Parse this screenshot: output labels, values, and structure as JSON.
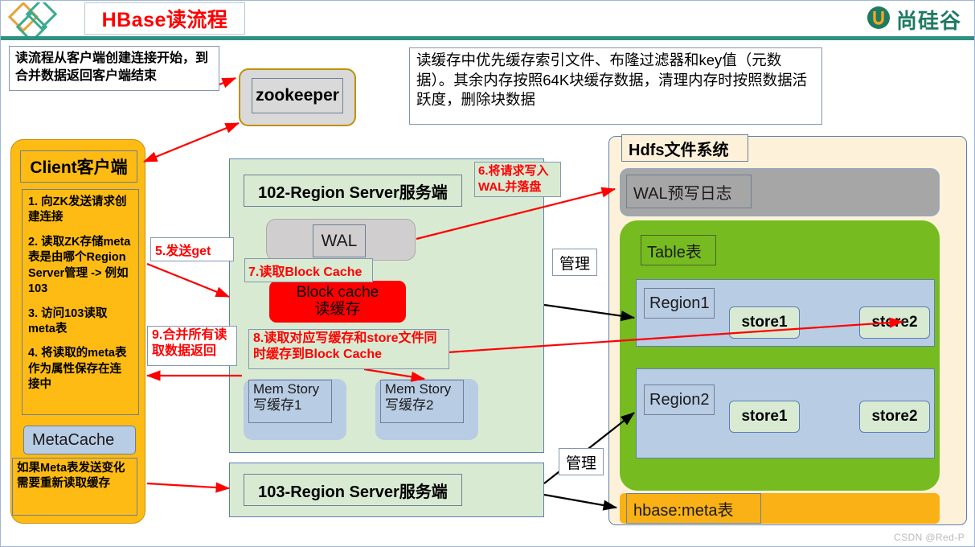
{
  "header": {
    "title": "HBase读流程",
    "brand_text": "尚硅谷",
    "logo_icon": "diamonds-logo-icon",
    "brand_icon": "u-circle-logo-icon"
  },
  "notes": {
    "left_note": "读流程从客户端创建连接开始，到合并数据返回客户端结束",
    "cache_note": "读缓存中优先缓存索引文件、布隆过滤器和key值（元数据）。其余内存按照64K块缓存数据，清理内存时按照数据活跃度，删除块数据"
  },
  "client": {
    "title": "Client客户端",
    "steps": [
      "1. 向ZK发送请求创建连接",
      "2. 读取ZK存储meta表是由哪个Region Server管理 -> 例如103",
      "3. 访问103读取meta表",
      "4. 将读取的meta表作为属性保存在连接中"
    ],
    "metacache": "MetaCache",
    "meta_note": "如果Meta表发送变化需要重新读取缓存"
  },
  "zookeeper": {
    "label": "zookeeper"
  },
  "region_server_102": {
    "title": "102-Region Server服务端",
    "wal": "WAL",
    "block_cache_line1": "Block cache",
    "block_cache_line2": "读缓存",
    "mem_store_1_line1": "Mem Story",
    "mem_store_1_line2": "写缓存1",
    "mem_store_2_line1": "Mem Story",
    "mem_store_2_line2": "写缓存2"
  },
  "region_server_103": {
    "title": "103-Region Server服务端"
  },
  "step_labels": {
    "step5": "5.发送get",
    "step6": "6.将请求写入WAL并落盘",
    "step7": "7.读取Block Cache",
    "step8": "8.读取对应写缓存和store文件同时缓存到Block Cache",
    "step9": "9.合并所有读取数据返回",
    "manage1": "管理",
    "manage2": "管理"
  },
  "hdfs": {
    "title": "Hdfs文件系统",
    "wal_log": "WAL预写日志",
    "table_label": "Table表",
    "regions": [
      {
        "label": "Region1",
        "stores": [
          "store1",
          "store2"
        ]
      },
      {
        "label": "Region2",
        "stores": [
          "store1",
          "store2"
        ]
      }
    ],
    "meta_table": "hbase:meta表"
  },
  "watermark": "CSDN @Red-P",
  "colors": {
    "title_red": "#ff0000",
    "client_orange": "#fdbb13",
    "region_server_green": "#d9ead3",
    "block_cache_red": "#ff0000",
    "hdfs_cream": "#fdf2d9",
    "table_green": "#76bc21",
    "region_blue": "#b8cce4",
    "meta_yellow": "#f9b116",
    "brand_green": "#1f7a62",
    "header_rule": "#2e9182"
  }
}
